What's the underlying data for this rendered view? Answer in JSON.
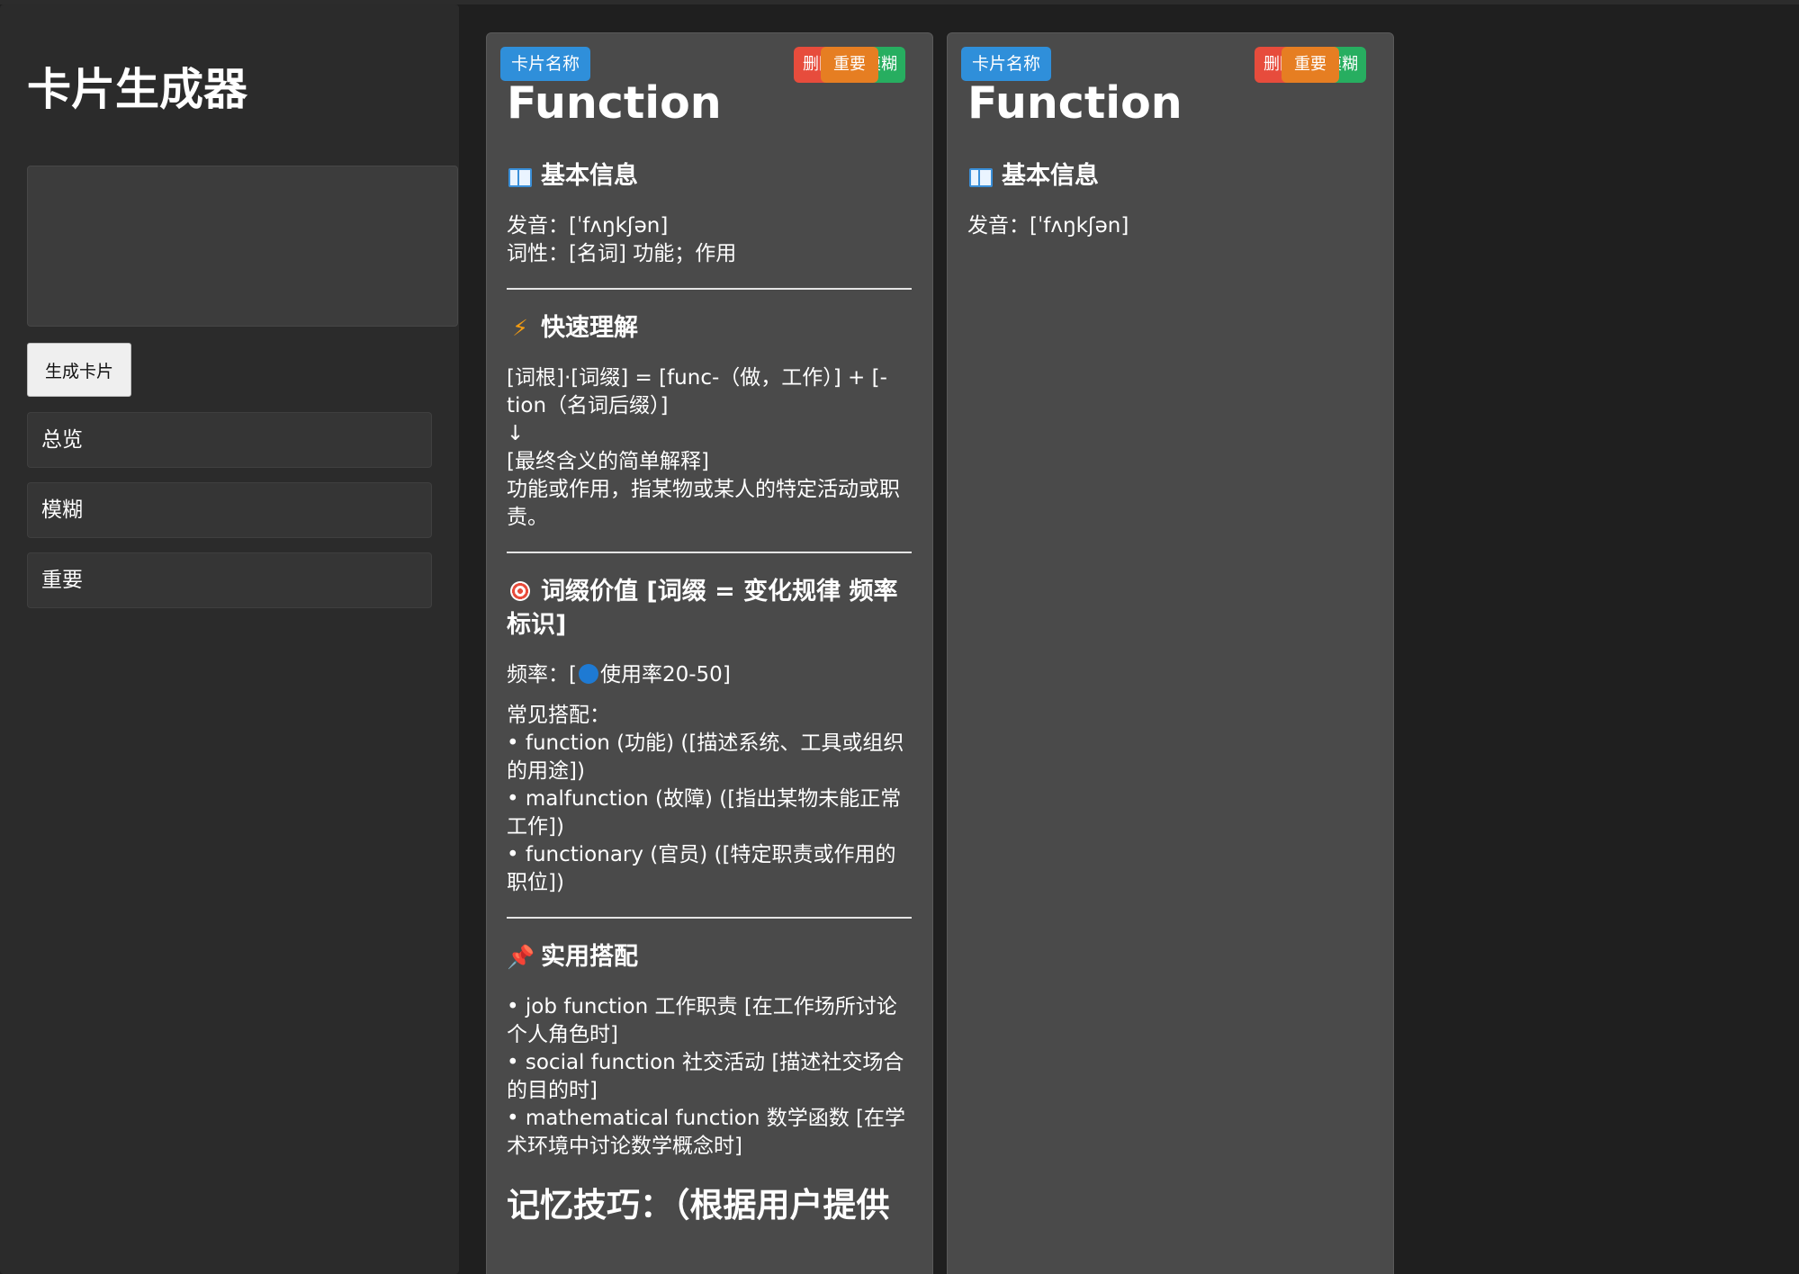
{
  "sidebar": {
    "title": "卡片生成器",
    "input_value": "",
    "generate_label": "生成卡片",
    "nav": [
      {
        "label": "总览"
      },
      {
        "label": "模糊"
      },
      {
        "label": "重要"
      }
    ]
  },
  "cards": [
    {
      "label": "卡片名称",
      "actions": {
        "delete": "删除",
        "important": "重要",
        "blur": "模糊"
      },
      "title": "Function",
      "sections": {
        "basic": {
          "icon": "book-icon",
          "heading": "基本信息",
          "pronunciation": "发音：[ˈfʌŋkʃən]",
          "pos": "词性：[名词] 功能；作用"
        },
        "quick": {
          "icon": "lightning-icon",
          "heading": "快速理解",
          "formula": "[词根]·[词缀] = [func-（做，工作）] + [-tion（名词后缀）]",
          "arrow": "↓",
          "final_label": "[最终含义的简单解释]",
          "final_text": "功能或作用，指某物或某人的特定活动或职责。"
        },
        "affix": {
          "icon": "target-icon",
          "heading": "词缀价值 [词缀 = 变化规律 频率标识]",
          "freq_prefix": "频率：[",
          "freq_text": "使用率20-50]",
          "collocation_label": "常见搭配：",
          "collocations": [
            "• function (功能) ([描述系统、工具或组织的用途])",
            "• malfunction (故障) ([指出某物未能正常工作])",
            "• functionary (官员) ([特定职责或作用的职位])"
          ]
        },
        "usage": {
          "icon": "pushpin-icon",
          "heading": "实用搭配",
          "items": [
            "• job function 工作职责 [在工作场所讨论个人角色时]",
            "• social function 社交活动 [描述社交场合的目的时]",
            "• mathematical function 数学函数 [在学术环境中讨论数学概念时]"
          ]
        },
        "mnemonic": "记忆技巧：（根据用户提供"
      }
    },
    {
      "label": "卡片名称",
      "actions": {
        "delete": "删除",
        "important": "重要",
        "blur": "模糊"
      },
      "title": "Function",
      "sections": {
        "basic": {
          "icon": "book-icon",
          "heading": "基本信息",
          "pronunciation": "发音：[ˈfʌŋkʃən]"
        }
      }
    }
  ]
}
